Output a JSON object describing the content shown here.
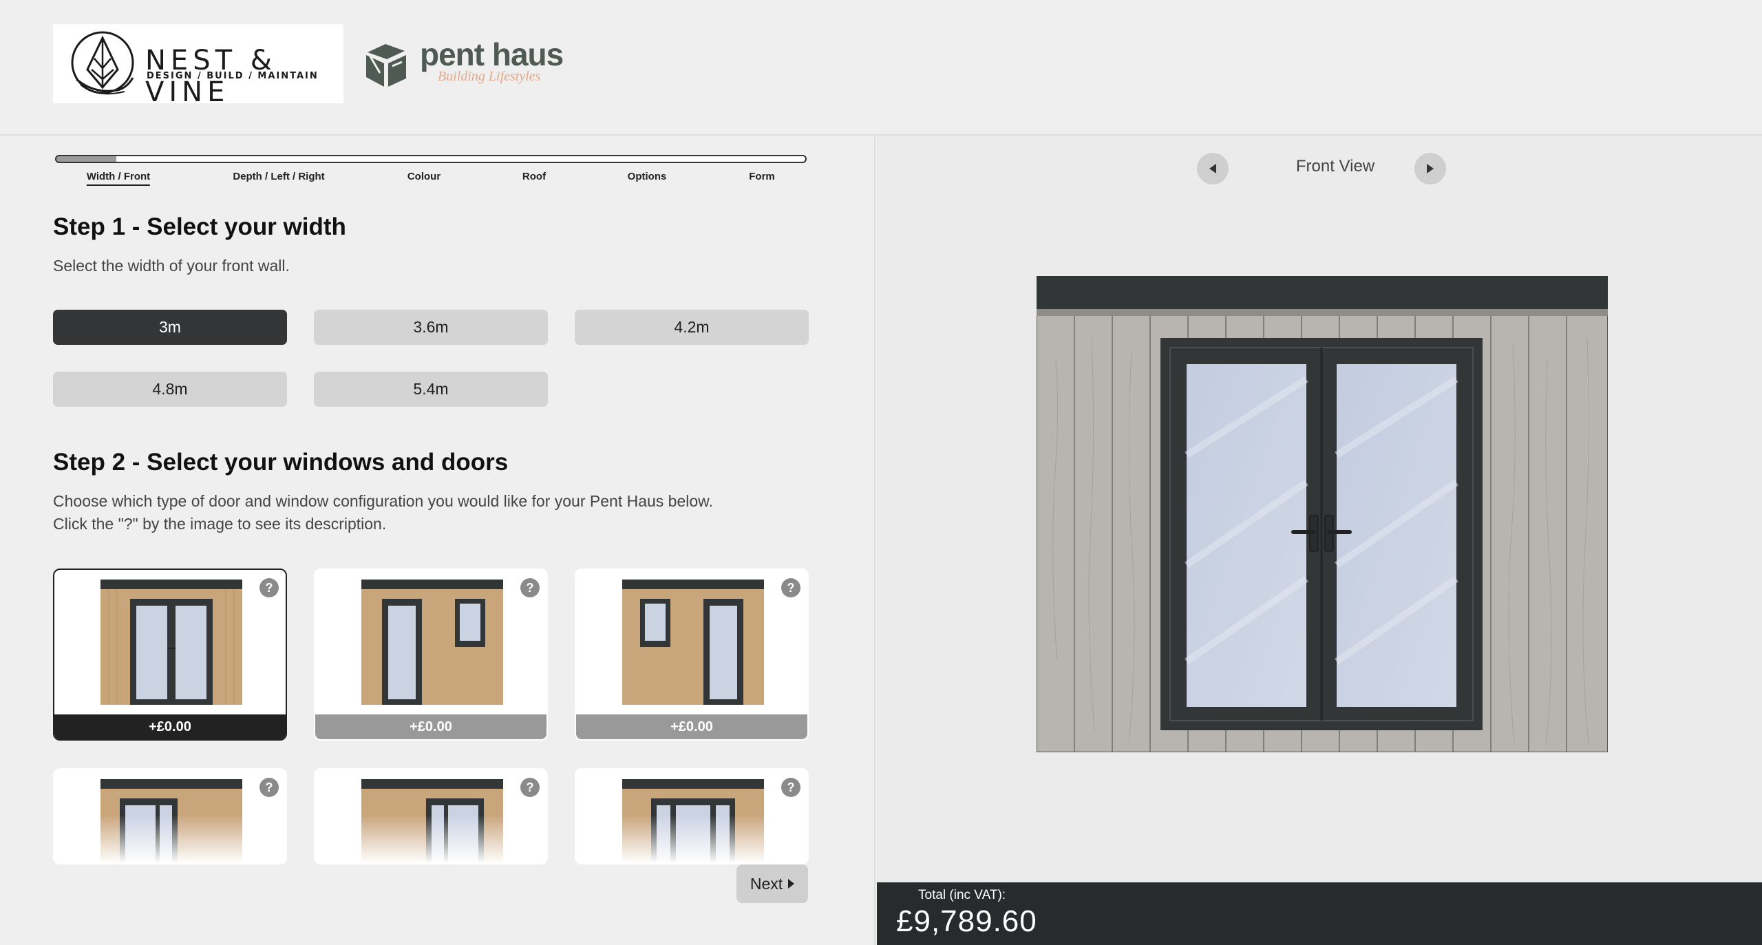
{
  "brand": {
    "nest_vine_name": "NEST & VINE",
    "nest_vine_tagline": "DESIGN / BUILD / MAINTAIN",
    "pent_haus_name": "pent haus",
    "pent_haus_tagline": "Building Lifestyles"
  },
  "progress": {
    "fraction_complete": 0.08,
    "steps": [
      "Width / Front",
      "Depth / Left / Right",
      "Colour",
      "Roof",
      "Options",
      "Form"
    ],
    "active_index": 0
  },
  "step1": {
    "title": "Step 1 - Select your width",
    "description": "Select the width of your front wall.",
    "options": [
      "3m",
      "3.6m",
      "4.2m",
      "4.8m",
      "5.4m"
    ],
    "selected": "3m"
  },
  "step2": {
    "title": "Step 2 - Select your windows and doors",
    "description_line1": "Choose which type of door and window configuration you would like for your Pent Haus below.",
    "description_line2": "Click the \"?\" by the image to see its description.",
    "help_glyph": "?",
    "cards": [
      {
        "price": "+£0.00",
        "selected": true
      },
      {
        "price": "+£0.00",
        "selected": false
      },
      {
        "price": "+£0.00",
        "selected": false
      }
    ]
  },
  "nav": {
    "next_label": "Next"
  },
  "viewer": {
    "view_label": "Front View"
  },
  "total": {
    "label": "Total (inc VAT):",
    "value": "£9,789.60"
  },
  "colors": {
    "dark": "#333536",
    "cladding_grey": "#b8b5b0",
    "cladding_wood": "#c9a57c",
    "frame": "#323637",
    "glass": "#cbd3e3",
    "accent_orange": "#e2a98a"
  },
  "icons": {
    "prev": "triangle-left-icon",
    "next": "triangle-right-icon",
    "help": "question-icon"
  }
}
